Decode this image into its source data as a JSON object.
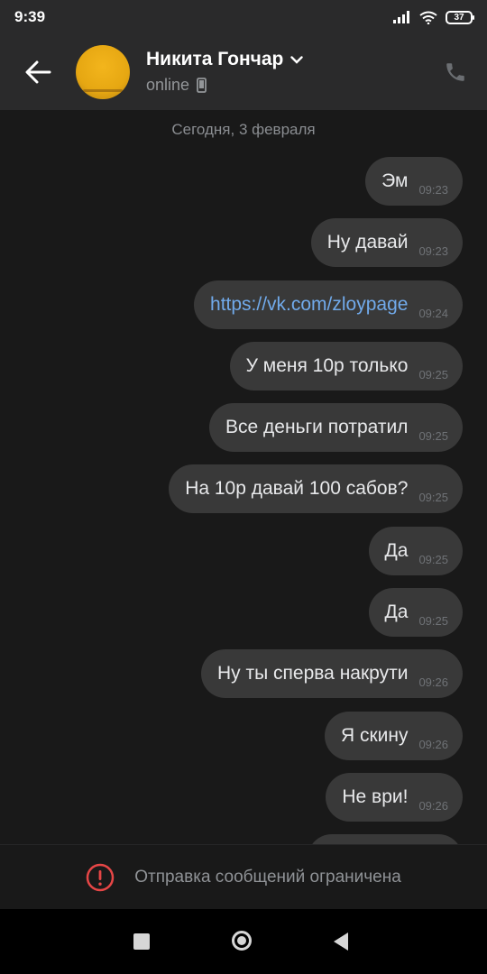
{
  "status_bar": {
    "time": "9:39",
    "battery": "37"
  },
  "header": {
    "name": "Никита Гончар",
    "status": "online"
  },
  "chat": {
    "date": "Сегодня, 3 февраля",
    "messages": [
      {
        "text": "Эм",
        "time": "09:23"
      },
      {
        "text": "Ну давай",
        "time": "09:23"
      },
      {
        "text": "https://vk.com/zloypage",
        "time": "09:24",
        "link": true
      },
      {
        "text": "У меня 10р только",
        "time": "09:25"
      },
      {
        "text": "Все деньги потратил",
        "time": "09:25"
      },
      {
        "text": "На 10р давай 100 сабов?",
        "time": "09:25"
      },
      {
        "text": "Да",
        "time": "09:25"
      },
      {
        "text": "Да",
        "time": "09:25"
      },
      {
        "text": "Ну ты сперва накрути",
        "time": "09:26"
      },
      {
        "text": "Я скину",
        "time": "09:26"
      },
      {
        "text": "Не ври!",
        "time": "09:26"
      }
    ]
  },
  "restriction": {
    "text": "Отправка сообщений ограничена"
  },
  "colors": {
    "bubble": "#393939",
    "link": "#71aaeb",
    "alert": "#e64646",
    "background": "#191919"
  },
  "icons": {
    "back": "arrow-left-icon",
    "call": "phone-icon",
    "device": "mobile-device-icon",
    "alert": "exclamation-circle-icon",
    "nav_recent": "square-icon",
    "nav_home": "circle-icon",
    "nav_back": "triangle-back-icon"
  }
}
